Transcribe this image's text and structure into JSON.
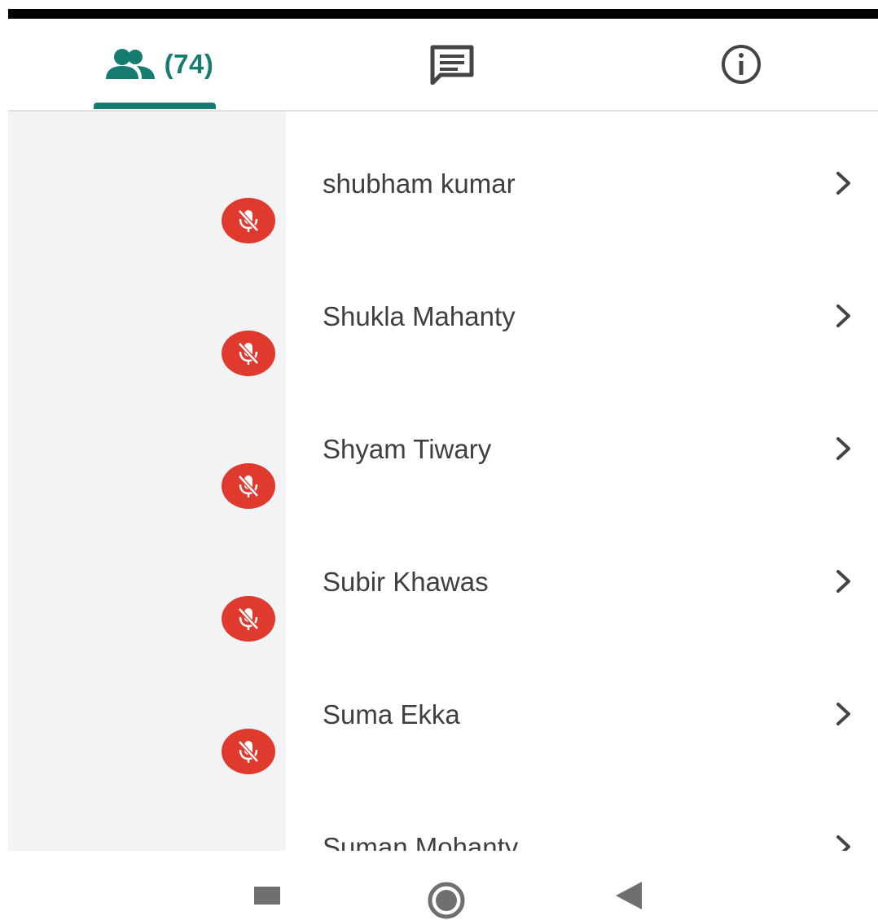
{
  "tabs": {
    "people": {
      "count_label": "(74)",
      "icon": "people-icon",
      "active": true
    },
    "chat": {
      "icon": "chat-icon"
    },
    "info": {
      "icon": "info-icon"
    }
  },
  "participants": [
    {
      "name": "shubham kumar",
      "status_icon": "mic-off-icon"
    },
    {
      "name": "Shukla Mahanty",
      "status_icon": "mic-off-icon"
    },
    {
      "name": "Shyam Tiwary",
      "status_icon": "mic-off-icon"
    },
    {
      "name": "Subir Khawas",
      "status_icon": "mic-off-icon"
    },
    {
      "name": "Suma Ekka",
      "status_icon": "mic-off-icon"
    },
    {
      "name": "Suman Mohanty",
      "status_icon": "mic-off-icon"
    }
  ],
  "colors": {
    "accent": "#167c72",
    "mute_badge": "#e03a2f",
    "sidebar_gray": "#f1f3f4"
  },
  "nav": {
    "recents": "recents-button",
    "home": "home-button",
    "back": "back-button"
  }
}
